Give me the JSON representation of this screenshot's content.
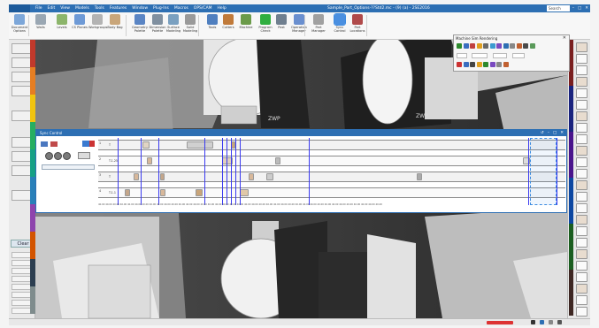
{
  "app": {
    "menu_button": "",
    "menu_items": [
      "File",
      "Edit",
      "View",
      "Models",
      "Tools",
      "Features",
      "Window",
      "Plug-Ins",
      "Macros",
      "OPS/CAM",
      "Help"
    ],
    "window_title": "Sample_Part_Options-??Std2.mc - (9) (a) - 2SE2016",
    "search_placeholder": "Search",
    "window_controls": [
      "–",
      "□",
      "✕"
    ]
  },
  "ribbon": {
    "groups": [
      {
        "label": "Document Options",
        "icon": "document-icon",
        "color": "#7da7d9"
      },
      {
        "label": "Walls",
        "icon": "gear-icon",
        "color": "#9aa7b3"
      },
      {
        "label": "Levels",
        "icon": "levels-icon",
        "color": "#8cb56b"
      },
      {
        "label": "CS Planes",
        "icon": "planes-icon",
        "color": "#6e9ad6"
      },
      {
        "label": "Workgroups",
        "icon": "workgroup-icon",
        "color": "#b3b3b3"
      },
      {
        "label": "Body Bag",
        "icon": "bag-icon",
        "color": "#c9a67a"
      },
      {
        "label": "Geometry Palette",
        "icon": "geometry-icon",
        "color": "#5a85c4"
      },
      {
        "label": "Dimension Palette",
        "icon": "dimension-icon",
        "color": "#8090a0"
      },
      {
        "label": "Surface Modeling",
        "icon": "surface-icon",
        "color": "#7aa0c0"
      },
      {
        "label": "Solid Modeling",
        "icon": "solid-icon",
        "color": "#9a9a9a"
      },
      {
        "label": "Tools",
        "icon": "tools-icon",
        "color": "#4f7fbf"
      },
      {
        "label": "Cutters",
        "icon": "cutter-icon",
        "color": "#c07a3a"
      },
      {
        "label": "Machine",
        "icon": "machine-icon",
        "color": "#6b9b4a"
      },
      {
        "label": "Program Check",
        "icon": "check-icon",
        "color": "#2fae3f"
      },
      {
        "label": "Post",
        "icon": "post-icon",
        "color": "#6f7f8f"
      },
      {
        "label": "Operation Manager",
        "icon": "opmanager-icon",
        "color": "#6a8fcf"
      },
      {
        "label": "Part Manager",
        "icon": "partmanager-icon",
        "color": "#a0a0a0"
      },
      {
        "label": "Sync Control",
        "icon": "sync-icon",
        "color": "#4a8fe0"
      },
      {
        "label": "Part Locations",
        "icon": "location-icon",
        "color": "#b04a4a"
      }
    ]
  },
  "left_palette": {
    "buttons": [
      "",
      "",
      "",
      "",
      "",
      "",
      "",
      "",
      ""
    ],
    "clear_label": "Clear"
  },
  "sim_dialog": {
    "title": "Machine Sim Rendering",
    "close": "✕",
    "field_values": [
      "",
      "",
      "",
      ""
    ]
  },
  "sync": {
    "title": "Sync Control",
    "controls": [
      "↺",
      "–",
      "□",
      "✕"
    ],
    "tracks": [
      {
        "label": "1",
        "sublabel": "T"
      },
      {
        "label": "2",
        "sublabel": "T.1.25"
      },
      {
        "label": "3",
        "sublabel": "T"
      },
      {
        "label": "4",
        "sublabel": "T.1.1"
      }
    ],
    "ruler_text": "40.00 40.00 40.00 40.00 40.00 40.00 40.00 40.00 40.00 40.00 40.00 40.00 40.00 40.00 40.00 40.00 40.00 40.00 40.00 40.00 40.00 40.00 40.00 40.00 40.00 40.00 40.00 40.00 40.00 40.00 40.00 40.00 40.00 40.00 40.00 40.00 40.00 40.00 40.00"
  },
  "viewport": {
    "label_brand_1": "ZWP",
    "label_brand_2": "ZWP"
  },
  "colors": {
    "accent": "#2d6fb3",
    "palette_strip": [
      "#c0392b",
      "#e67e22",
      "#f1c40f",
      "#27ae60",
      "#16a085",
      "#2980b9",
      "#8e44ad",
      "#d35400",
      "#2c3e50",
      "#7f8c8d"
    ],
    "right_strip": [
      "#7a1f1f",
      "#1a237e",
      "#4a148c",
      "#0d47a1",
      "#1b5e20",
      "#3e2723"
    ]
  }
}
